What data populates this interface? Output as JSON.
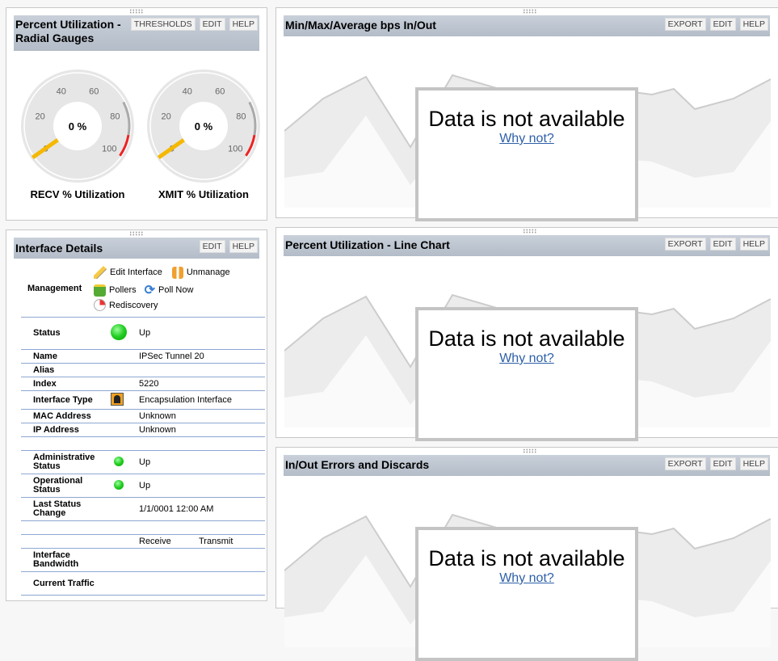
{
  "gauges_panel": {
    "title": "Percent Utilization - Radial Gauges",
    "buttons": [
      "THRESHOLDS",
      "EDIT",
      "HELP"
    ],
    "gauges": [
      {
        "label": "RECV % Utilization",
        "value_text": "0 %",
        "value": 0
      },
      {
        "label": "XMIT % Utilization",
        "value_text": "0 %",
        "value": 0
      }
    ],
    "ticks": [
      "0",
      "20",
      "40",
      "60",
      "80",
      "100"
    ],
    "warn_color": "#aaaaaa",
    "crit_color": "#ee2222",
    "needle_color": "#f5b800"
  },
  "details_panel": {
    "title": "Interface Details",
    "buttons": [
      "EDIT",
      "HELP"
    ],
    "management": {
      "label": "Management",
      "actions": [
        "Edit Interface",
        "Unmanage",
        "Pollers",
        "Poll Now",
        "Rediscovery"
      ]
    },
    "rows": [
      {
        "key": "Status",
        "value": "Up",
        "icon": "green-status-icon"
      },
      {
        "key": "Name",
        "value": "IPSec Tunnel 20"
      },
      {
        "key": "Alias",
        "value": ""
      },
      {
        "key": "Index",
        "value": "5220"
      },
      {
        "key": "Interface Type",
        "value": "Encapsulation Interface",
        "icon": "interface-type-icon"
      },
      {
        "key": "MAC Address",
        "value": "Unknown"
      },
      {
        "key": "IP Address",
        "value": "Unknown"
      },
      {
        "key": "",
        "value": ""
      },
      {
        "key": "Administrative Status",
        "value": "Up",
        "icon": "green-dot-icon"
      },
      {
        "key": "Operational Status",
        "value": "Up",
        "icon": "green-dot-icon"
      },
      {
        "key": "Last Status Change",
        "value": "1/1/0001 12:00 AM"
      },
      {
        "key": "",
        "value": ""
      }
    ],
    "traffic_headers": [
      "Receive",
      "Transmit"
    ],
    "traffic_rows": [
      "Interface Bandwidth",
      "Current Traffic"
    ]
  },
  "chart_panels": [
    {
      "title": "Min/Max/Average bps In/Out",
      "buttons": [
        "EXPORT",
        "EDIT",
        "HELP"
      ],
      "message": "Data is not available",
      "link": "Why not?"
    },
    {
      "title": "Percent Utilization - Line Chart",
      "buttons": [
        "EXPORT",
        "EDIT",
        "HELP"
      ],
      "message": "Data is not available",
      "link": "Why not?"
    },
    {
      "title": "In/Out Errors and Discards",
      "buttons": [
        "EXPORT",
        "EDIT",
        "HELP"
      ],
      "message": "Data is not available",
      "link": "Why not?"
    }
  ]
}
